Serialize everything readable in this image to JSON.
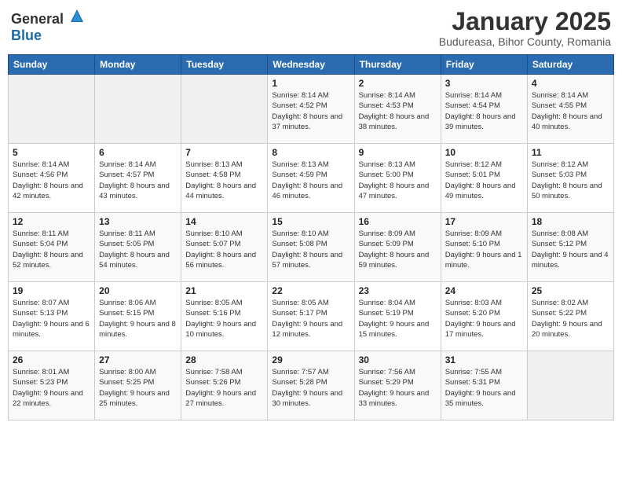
{
  "logo": {
    "general": "General",
    "blue": "Blue"
  },
  "header": {
    "month": "January 2025",
    "location": "Budureasa, Bihor County, Romania"
  },
  "weekdays": [
    "Sunday",
    "Monday",
    "Tuesday",
    "Wednesday",
    "Thursday",
    "Friday",
    "Saturday"
  ],
  "weeks": [
    [
      {
        "day": "",
        "info": ""
      },
      {
        "day": "",
        "info": ""
      },
      {
        "day": "",
        "info": ""
      },
      {
        "day": "1",
        "info": "Sunrise: 8:14 AM\nSunset: 4:52 PM\nDaylight: 8 hours and 37 minutes."
      },
      {
        "day": "2",
        "info": "Sunrise: 8:14 AM\nSunset: 4:53 PM\nDaylight: 8 hours and 38 minutes."
      },
      {
        "day": "3",
        "info": "Sunrise: 8:14 AM\nSunset: 4:54 PM\nDaylight: 8 hours and 39 minutes."
      },
      {
        "day": "4",
        "info": "Sunrise: 8:14 AM\nSunset: 4:55 PM\nDaylight: 8 hours and 40 minutes."
      }
    ],
    [
      {
        "day": "5",
        "info": "Sunrise: 8:14 AM\nSunset: 4:56 PM\nDaylight: 8 hours and 42 minutes."
      },
      {
        "day": "6",
        "info": "Sunrise: 8:14 AM\nSunset: 4:57 PM\nDaylight: 8 hours and 43 minutes."
      },
      {
        "day": "7",
        "info": "Sunrise: 8:13 AM\nSunset: 4:58 PM\nDaylight: 8 hours and 44 minutes."
      },
      {
        "day": "8",
        "info": "Sunrise: 8:13 AM\nSunset: 4:59 PM\nDaylight: 8 hours and 46 minutes."
      },
      {
        "day": "9",
        "info": "Sunrise: 8:13 AM\nSunset: 5:00 PM\nDaylight: 8 hours and 47 minutes."
      },
      {
        "day": "10",
        "info": "Sunrise: 8:12 AM\nSunset: 5:01 PM\nDaylight: 8 hours and 49 minutes."
      },
      {
        "day": "11",
        "info": "Sunrise: 8:12 AM\nSunset: 5:03 PM\nDaylight: 8 hours and 50 minutes."
      }
    ],
    [
      {
        "day": "12",
        "info": "Sunrise: 8:11 AM\nSunset: 5:04 PM\nDaylight: 8 hours and 52 minutes."
      },
      {
        "day": "13",
        "info": "Sunrise: 8:11 AM\nSunset: 5:05 PM\nDaylight: 8 hours and 54 minutes."
      },
      {
        "day": "14",
        "info": "Sunrise: 8:10 AM\nSunset: 5:07 PM\nDaylight: 8 hours and 56 minutes."
      },
      {
        "day": "15",
        "info": "Sunrise: 8:10 AM\nSunset: 5:08 PM\nDaylight: 8 hours and 57 minutes."
      },
      {
        "day": "16",
        "info": "Sunrise: 8:09 AM\nSunset: 5:09 PM\nDaylight: 8 hours and 59 minutes."
      },
      {
        "day": "17",
        "info": "Sunrise: 8:09 AM\nSunset: 5:10 PM\nDaylight: 9 hours and 1 minute."
      },
      {
        "day": "18",
        "info": "Sunrise: 8:08 AM\nSunset: 5:12 PM\nDaylight: 9 hours and 4 minutes."
      }
    ],
    [
      {
        "day": "19",
        "info": "Sunrise: 8:07 AM\nSunset: 5:13 PM\nDaylight: 9 hours and 6 minutes."
      },
      {
        "day": "20",
        "info": "Sunrise: 8:06 AM\nSunset: 5:15 PM\nDaylight: 9 hours and 8 minutes."
      },
      {
        "day": "21",
        "info": "Sunrise: 8:05 AM\nSunset: 5:16 PM\nDaylight: 9 hours and 10 minutes."
      },
      {
        "day": "22",
        "info": "Sunrise: 8:05 AM\nSunset: 5:17 PM\nDaylight: 9 hours and 12 minutes."
      },
      {
        "day": "23",
        "info": "Sunrise: 8:04 AM\nSunset: 5:19 PM\nDaylight: 9 hours and 15 minutes."
      },
      {
        "day": "24",
        "info": "Sunrise: 8:03 AM\nSunset: 5:20 PM\nDaylight: 9 hours and 17 minutes."
      },
      {
        "day": "25",
        "info": "Sunrise: 8:02 AM\nSunset: 5:22 PM\nDaylight: 9 hours and 20 minutes."
      }
    ],
    [
      {
        "day": "26",
        "info": "Sunrise: 8:01 AM\nSunset: 5:23 PM\nDaylight: 9 hours and 22 minutes."
      },
      {
        "day": "27",
        "info": "Sunrise: 8:00 AM\nSunset: 5:25 PM\nDaylight: 9 hours and 25 minutes."
      },
      {
        "day": "28",
        "info": "Sunrise: 7:58 AM\nSunset: 5:26 PM\nDaylight: 9 hours and 27 minutes."
      },
      {
        "day": "29",
        "info": "Sunrise: 7:57 AM\nSunset: 5:28 PM\nDaylight: 9 hours and 30 minutes."
      },
      {
        "day": "30",
        "info": "Sunrise: 7:56 AM\nSunset: 5:29 PM\nDaylight: 9 hours and 33 minutes."
      },
      {
        "day": "31",
        "info": "Sunrise: 7:55 AM\nSunset: 5:31 PM\nDaylight: 9 hours and 35 minutes."
      },
      {
        "day": "",
        "info": ""
      }
    ]
  ]
}
